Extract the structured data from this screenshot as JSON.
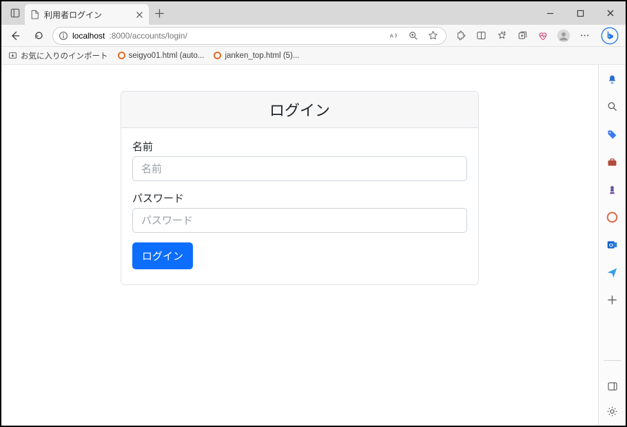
{
  "window": {
    "tab_title": "利用者ログイン"
  },
  "address": {
    "host": "localhost",
    "rest": ":8000/accounts/login/"
  },
  "favorites": {
    "import_label": "お気に入りのインポート",
    "items": [
      {
        "label": "seigyo01.html (auto..."
      },
      {
        "label": "janken_top.html (5)..."
      }
    ]
  },
  "login": {
    "header": "ログイン",
    "name_label": "名前",
    "name_placeholder": "名前",
    "password_label": "パスワード",
    "password_placeholder": "パスワード",
    "submit_label": "ログイン"
  },
  "colors": {
    "primary": "#0d6efd",
    "bing_blue": "#1a73e8"
  }
}
